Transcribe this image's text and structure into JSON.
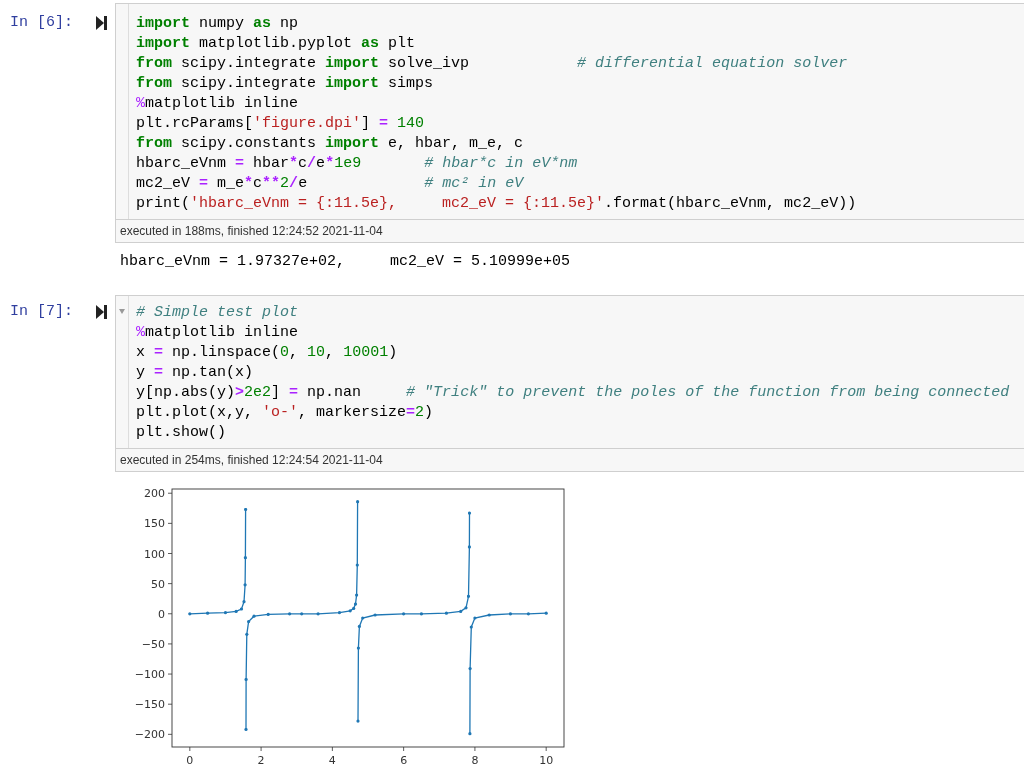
{
  "cells": [
    {
      "prompt": "In [6]:",
      "fold_toggle": false,
      "lines": [
        [
          {
            "kind": "keyword",
            "text": "import"
          },
          {
            "kind": "plain",
            "text": " numpy "
          },
          {
            "kind": "keyword",
            "text": "as"
          },
          {
            "kind": "plain",
            "text": " np"
          }
        ],
        [
          {
            "kind": "keyword",
            "text": "import"
          },
          {
            "kind": "plain",
            "text": " matplotlib.pyplot "
          },
          {
            "kind": "keyword",
            "text": "as"
          },
          {
            "kind": "plain",
            "text": " plt"
          }
        ],
        [
          {
            "kind": "keyword",
            "text": "from"
          },
          {
            "kind": "plain",
            "text": " scipy.integrate "
          },
          {
            "kind": "keyword",
            "text": "import"
          },
          {
            "kind": "plain",
            "text": " solve_ivp"
          },
          {
            "kind": "comment",
            "text": "            # differential equation solver"
          }
        ],
        [
          {
            "kind": "keyword",
            "text": "from"
          },
          {
            "kind": "plain",
            "text": " scipy.integrate "
          },
          {
            "kind": "keyword",
            "text": "import"
          },
          {
            "kind": "plain",
            "text": " simps"
          }
        ],
        [
          {
            "kind": "magic",
            "text": "%"
          },
          {
            "kind": "plain",
            "text": "matplotlib inline"
          }
        ],
        [
          {
            "kind": "plain",
            "text": "plt.rcParams["
          },
          {
            "kind": "string",
            "text": "'figure.dpi'"
          },
          {
            "kind": "plain",
            "text": "] "
          },
          {
            "kind": "operator",
            "text": "="
          },
          {
            "kind": "number",
            "text": " 140"
          }
        ],
        [
          {
            "kind": "keyword",
            "text": "from"
          },
          {
            "kind": "plain",
            "text": " scipy.constants "
          },
          {
            "kind": "keyword",
            "text": "import"
          },
          {
            "kind": "plain",
            "text": " e, hbar, m_e, c"
          }
        ],
        [
          {
            "kind": "plain",
            "text": "hbarc_eVnm "
          },
          {
            "kind": "operator",
            "text": "="
          },
          {
            "kind": "plain",
            "text": " hbar"
          },
          {
            "kind": "operator",
            "text": "*"
          },
          {
            "kind": "plain",
            "text": "c"
          },
          {
            "kind": "operator",
            "text": "/"
          },
          {
            "kind": "plain",
            "text": "e"
          },
          {
            "kind": "operator",
            "text": "*"
          },
          {
            "kind": "number",
            "text": "1e9"
          },
          {
            "kind": "comment",
            "text": "       # hbar*c in eV*nm"
          }
        ],
        [
          {
            "kind": "plain",
            "text": "mc2_eV "
          },
          {
            "kind": "operator",
            "text": "="
          },
          {
            "kind": "plain",
            "text": " m_e"
          },
          {
            "kind": "operator",
            "text": "*"
          },
          {
            "kind": "plain",
            "text": "c"
          },
          {
            "kind": "operator",
            "text": "**"
          },
          {
            "kind": "number",
            "text": "2"
          },
          {
            "kind": "operator",
            "text": "/"
          },
          {
            "kind": "plain",
            "text": "e"
          },
          {
            "kind": "comment",
            "text": "             # mc² in eV"
          }
        ],
        [
          {
            "kind": "plain",
            "text": "print("
          },
          {
            "kind": "string",
            "text": "'hbarc_eVnm = {:11.5e},     mc2_eV = {:11.5e}'"
          },
          {
            "kind": "plain",
            "text": ".format(hbarc_eVnm, mc2_eV))"
          }
        ]
      ],
      "executed": "executed in 188ms, finished 12:24:52 2021-11-04",
      "output": {
        "kind": "text",
        "text": "hbarc_eVnm = 1.97327e+02,     mc2_eV = 5.10999e+05"
      }
    },
    {
      "prompt": "In [7]:",
      "fold_toggle": true,
      "lines": [
        [
          {
            "kind": "comment",
            "text": "# Simple test plot"
          }
        ],
        [
          {
            "kind": "magic",
            "text": "%"
          },
          {
            "kind": "plain",
            "text": "matplotlib inline"
          }
        ],
        [
          {
            "kind": "plain",
            "text": "x "
          },
          {
            "kind": "operator",
            "text": "="
          },
          {
            "kind": "plain",
            "text": " np.linspace("
          },
          {
            "kind": "number",
            "text": "0"
          },
          {
            "kind": "plain",
            "text": ", "
          },
          {
            "kind": "number",
            "text": "10"
          },
          {
            "kind": "plain",
            "text": ", "
          },
          {
            "kind": "number",
            "text": "10001"
          },
          {
            "kind": "plain",
            "text": ")"
          }
        ],
        [
          {
            "kind": "plain",
            "text": "y "
          },
          {
            "kind": "operator",
            "text": "="
          },
          {
            "kind": "plain",
            "text": " np.tan(x)"
          }
        ],
        [
          {
            "kind": "plain",
            "text": "y[np.abs(y)"
          },
          {
            "kind": "operator",
            "text": ">"
          },
          {
            "kind": "number",
            "text": "2e2"
          },
          {
            "kind": "plain",
            "text": "] "
          },
          {
            "kind": "operator",
            "text": "="
          },
          {
            "kind": "plain",
            "text": " np.nan"
          },
          {
            "kind": "comment",
            "text": "     # \"Trick\" to prevent the poles of the function from being connected"
          }
        ],
        [
          {
            "kind": "plain",
            "text": "plt.plot(x,y, "
          },
          {
            "kind": "string",
            "text": "'o-'"
          },
          {
            "kind": "plain",
            "text": ", markersize"
          },
          {
            "kind": "operator",
            "text": "="
          },
          {
            "kind": "number",
            "text": "2"
          },
          {
            "kind": "plain",
            "text": ")"
          }
        ],
        [
          {
            "kind": "plain",
            "text": "plt.show()"
          }
        ]
      ],
      "executed": "executed in 254ms, finished 12:24:54 2021-11-04",
      "output": {
        "kind": "chart",
        "chart_data": {
          "type": "line",
          "xlim": [
            -0.5,
            10.5
          ],
          "ylim": [
            -221,
            207
          ],
          "xticks": [
            0,
            2,
            4,
            6,
            8,
            10
          ],
          "yticks": [
            {
              "value": -200,
              "label": "−200"
            },
            {
              "value": -150,
              "label": "−150"
            },
            {
              "value": -100,
              "label": "−100"
            },
            {
              "value": -50,
              "label": "−50"
            },
            0,
            50,
            100,
            150,
            200
          ],
          "x": [
            0,
            0.5,
            1,
            1.3,
            1.45,
            1.52,
            1.55,
            1.56,
            1.565,
            1.571,
            1.576,
            1.58,
            1.6,
            1.65,
            1.8,
            2.2,
            2.8,
            3.14,
            3.6,
            4.2,
            4.5,
            4.6,
            4.65,
            4.68,
            4.7,
            4.707,
            4.712,
            4.718,
            4.73,
            4.76,
            4.85,
            5.2,
            6,
            6.5,
            7.2,
            7.6,
            7.75,
            7.82,
            7.845,
            7.848,
            7.854,
            7.859,
            7.865,
            7.9,
            8,
            8.4,
            9,
            9.5,
            10
          ],
          "series": [
            {
              "color": "#1f77b4",
              "values": [
                0,
                1,
                2,
                4,
                8,
                20,
                48,
                93,
                173,
                null,
                -192,
                -109,
                -34,
                -13,
                -4,
                -1,
                0,
                0,
                0,
                2,
                5,
                9,
                16,
                31,
                81,
                186,
                null,
                -178,
                -57,
                -21,
                -7,
                -2,
                0,
                0,
                1,
                4,
                10,
                29,
                111,
                167,
                null,
                -199,
                -91,
                -22,
                -7,
                -2,
                0,
                0,
                1
              ]
            }
          ]
        }
      }
    }
  ]
}
